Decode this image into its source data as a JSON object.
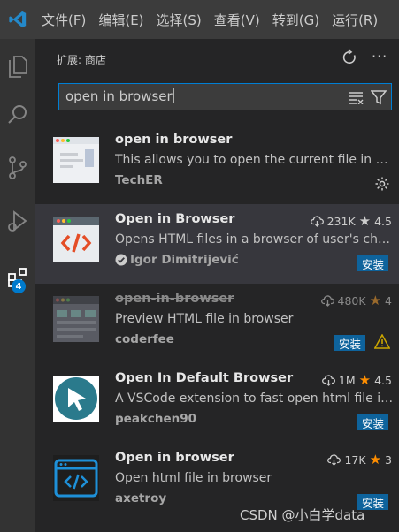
{
  "menu": [
    "文件(F)",
    "编辑(E)",
    "选择(S)",
    "查看(V)",
    "转到(G)",
    "运行(R)"
  ],
  "activity": {
    "extensions_badge": "4"
  },
  "sidebar": {
    "title": "扩展: 商店"
  },
  "search": {
    "value": "open in browser"
  },
  "extensions": [
    {
      "name": "open in browser",
      "description": "This allows you to open the current file in your default browser or application.",
      "publisher": "TechER"
    },
    {
      "name": "Open in Browser",
      "description": "Opens HTML files in a browser of user's choice",
      "publisher": "Igor Dimitrijević",
      "downloads": "231K",
      "rating": "4.5",
      "install": "安装"
    },
    {
      "name": "open-in-browser",
      "description": "Preview HTML file in browser",
      "publisher": "coderfee",
      "downloads": "480K",
      "rating": "4",
      "install": "安装"
    },
    {
      "name": "Open In Default Browser",
      "description": "A VSCode extension to fast open html file in browser",
      "publisher": "peakchen90",
      "downloads": "1M",
      "rating": "4.5",
      "install": "安装"
    },
    {
      "name": "Open in browser",
      "description": "Open html file in browser",
      "publisher": "axetroy",
      "downloads": "17K",
      "rating": "3",
      "install": "安装"
    }
  ],
  "watermark": "CSDN @小白学data",
  "colors": {
    "accent": "#007acc",
    "install": "#0e639c",
    "star": "#ff8e00",
    "warning": "#cca700"
  }
}
